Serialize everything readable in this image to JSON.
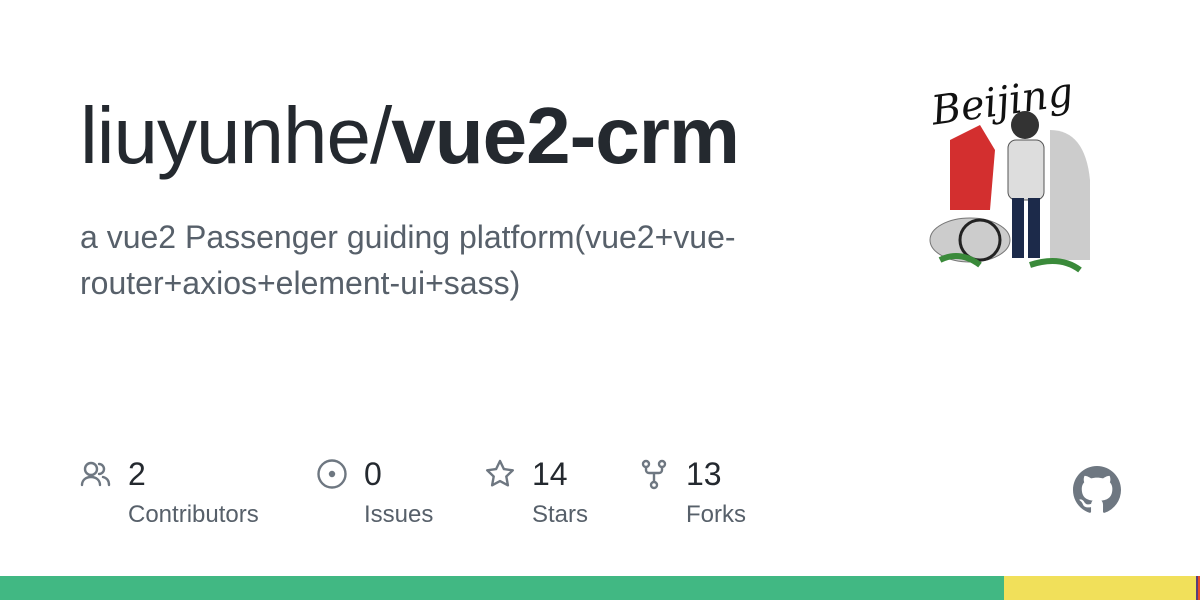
{
  "repo": {
    "owner": "liuyunhe/",
    "name": "vue2-crm",
    "description": "a vue2 Passenger guiding platform(vue2+vue-router+axios+element-ui+sass)"
  },
  "avatar": {
    "lettering": "Beijing"
  },
  "stats": [
    {
      "icon": "people-icon",
      "value": "2",
      "label": "Contributors"
    },
    {
      "icon": "issue-icon",
      "value": "0",
      "label": "Issues"
    },
    {
      "icon": "star-icon",
      "value": "14",
      "label": "Stars"
    },
    {
      "icon": "fork-icon",
      "value": "13",
      "label": "Forks"
    }
  ],
  "languages": [
    {
      "color": "#41b883",
      "percent": 83.7
    },
    {
      "color": "#f1e05a",
      "percent": 16.0
    },
    {
      "color": "#563d7c",
      "percent": 0.17
    },
    {
      "color": "#e34c26",
      "percent": 0.17
    }
  ],
  "colors": {
    "text": "#24292f",
    "muted": "#57606a",
    "icon": "#6e7781"
  }
}
